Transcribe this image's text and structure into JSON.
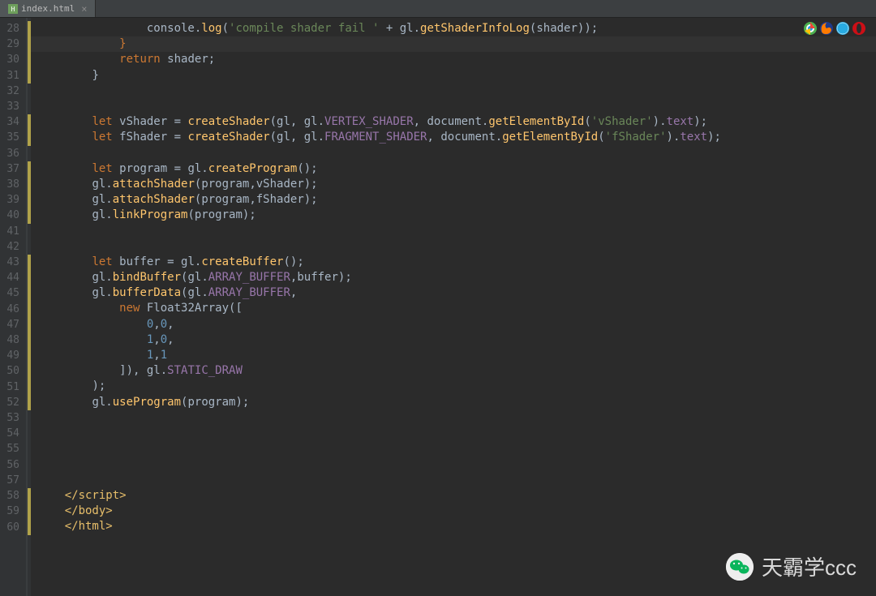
{
  "tab": {
    "label": "index.html",
    "close": "×"
  },
  "lineStart": 28,
  "lineEnd": 60,
  "highlightLine": 29,
  "changeRanges": [
    [
      28,
      31
    ],
    [
      34,
      35
    ],
    [
      37,
      40
    ],
    [
      43,
      52
    ],
    [
      58,
      60
    ]
  ],
  "code": {
    "l28": {
      "indent": "                ",
      "t": [
        [
          "pl",
          "console."
        ],
        [
          "fn",
          "log"
        ],
        [
          "pl",
          "("
        ],
        [
          "str",
          "'compile shader fail '"
        ],
        [
          "pl",
          " + gl."
        ],
        [
          "fn",
          "getShaderInfoLog"
        ],
        [
          "pl",
          "(shader));"
        ]
      ]
    },
    "l29": {
      "indent": "            ",
      "t": [
        [
          "curly",
          "}"
        ]
      ]
    },
    "l30": {
      "indent": "            ",
      "t": [
        [
          "kw",
          "return "
        ],
        [
          "pl",
          "shader;"
        ]
      ]
    },
    "l31": {
      "indent": "        ",
      "t": [
        [
          "pl",
          "}"
        ]
      ]
    },
    "l32": {
      "indent": "",
      "t": []
    },
    "l33": {
      "indent": "",
      "t": []
    },
    "l34": {
      "indent": "        ",
      "t": [
        [
          "kw",
          "let "
        ],
        [
          "pl",
          "vShader = "
        ],
        [
          "fn",
          "createShader"
        ],
        [
          "pl",
          "(gl, gl."
        ],
        [
          "prop",
          "VERTEX_SHADER"
        ],
        [
          "pl",
          ", document."
        ],
        [
          "fn",
          "getElementById"
        ],
        [
          "pl",
          "("
        ],
        [
          "str",
          "'vShader'"
        ],
        [
          "pl",
          ")."
        ],
        [
          "prop",
          "text"
        ],
        [
          "pl",
          ");"
        ]
      ]
    },
    "l35": {
      "indent": "        ",
      "t": [
        [
          "kw",
          "let "
        ],
        [
          "pl",
          "fShader = "
        ],
        [
          "fn",
          "createShader"
        ],
        [
          "pl",
          "(gl, gl."
        ],
        [
          "prop",
          "FRAGMENT_SHADER"
        ],
        [
          "pl",
          ", document."
        ],
        [
          "fn",
          "getElementById"
        ],
        [
          "pl",
          "("
        ],
        [
          "str",
          "'fShader'"
        ],
        [
          "pl",
          ")."
        ],
        [
          "prop",
          "text"
        ],
        [
          "pl",
          ");"
        ]
      ]
    },
    "l36": {
      "indent": "",
      "t": []
    },
    "l37": {
      "indent": "        ",
      "t": [
        [
          "kw",
          "let "
        ],
        [
          "pl",
          "program = gl."
        ],
        [
          "fn",
          "createProgram"
        ],
        [
          "pl",
          "();"
        ]
      ]
    },
    "l38": {
      "indent": "        ",
      "t": [
        [
          "pl",
          "gl."
        ],
        [
          "fn",
          "attachShader"
        ],
        [
          "pl",
          "(program,vShader);"
        ]
      ]
    },
    "l39": {
      "indent": "        ",
      "t": [
        [
          "pl",
          "gl."
        ],
        [
          "fn",
          "attachShader"
        ],
        [
          "pl",
          "(program,fShader);"
        ]
      ]
    },
    "l40": {
      "indent": "        ",
      "t": [
        [
          "pl",
          "gl."
        ],
        [
          "fn",
          "linkProgram"
        ],
        [
          "pl",
          "(program);"
        ]
      ]
    },
    "l41": {
      "indent": "",
      "t": []
    },
    "l42": {
      "indent": "",
      "t": []
    },
    "l43": {
      "indent": "        ",
      "t": [
        [
          "kw",
          "let "
        ],
        [
          "pl",
          "buffer = gl."
        ],
        [
          "fn",
          "createBuffer"
        ],
        [
          "pl",
          "();"
        ]
      ]
    },
    "l44": {
      "indent": "        ",
      "t": [
        [
          "pl",
          "gl."
        ],
        [
          "fn",
          "bindBuffer"
        ],
        [
          "pl",
          "(gl."
        ],
        [
          "prop",
          "ARRAY_BUFFER"
        ],
        [
          "pl",
          ",buffer);"
        ]
      ]
    },
    "l45": {
      "indent": "        ",
      "t": [
        [
          "pl",
          "gl."
        ],
        [
          "fn",
          "bufferData"
        ],
        [
          "pl",
          "(gl."
        ],
        [
          "prop",
          "ARRAY_BUFFER"
        ],
        [
          "pl",
          ","
        ]
      ]
    },
    "l46": {
      "indent": "            ",
      "t": [
        [
          "kw",
          "new "
        ],
        [
          "pl",
          "Float32Array(["
        ]
      ]
    },
    "l47": {
      "indent": "                ",
      "t": [
        [
          "num",
          "0"
        ],
        [
          "pl",
          ","
        ],
        [
          "num",
          "0"
        ],
        [
          "pl",
          ","
        ]
      ]
    },
    "l48": {
      "indent": "                ",
      "t": [
        [
          "num",
          "1"
        ],
        [
          "pl",
          ","
        ],
        [
          "num",
          "0"
        ],
        [
          "pl",
          ","
        ]
      ]
    },
    "l49": {
      "indent": "                ",
      "t": [
        [
          "num",
          "1"
        ],
        [
          "pl",
          ","
        ],
        [
          "num",
          "1"
        ]
      ]
    },
    "l50": {
      "indent": "            ",
      "t": [
        [
          "pl",
          "]), gl."
        ],
        [
          "prop",
          "STATIC_DRAW"
        ]
      ]
    },
    "l51": {
      "indent": "        ",
      "t": [
        [
          "pl",
          ");"
        ]
      ]
    },
    "l52": {
      "indent": "        ",
      "t": [
        [
          "pl",
          "gl."
        ],
        [
          "fn",
          "useProgram"
        ],
        [
          "pl",
          "(program);"
        ]
      ]
    },
    "l53": {
      "indent": "",
      "t": []
    },
    "l54": {
      "indent": "",
      "t": []
    },
    "l55": {
      "indent": "",
      "t": []
    },
    "l56": {
      "indent": "",
      "t": []
    },
    "l57": {
      "indent": "",
      "t": []
    },
    "l58": {
      "indent": "    ",
      "t": [
        [
          "tag",
          "</script"
        ],
        [
          "tag",
          ">"
        ]
      ]
    },
    "l59": {
      "indent": "    ",
      "t": [
        [
          "tag",
          "</body>"
        ]
      ]
    },
    "l60": {
      "indent": "    ",
      "t": [
        [
          "tag",
          "</html>"
        ]
      ]
    }
  },
  "browserIcons": [
    "chrome",
    "firefox",
    "safari",
    "opera"
  ],
  "watermark": {
    "text": "天霸学ccc"
  }
}
